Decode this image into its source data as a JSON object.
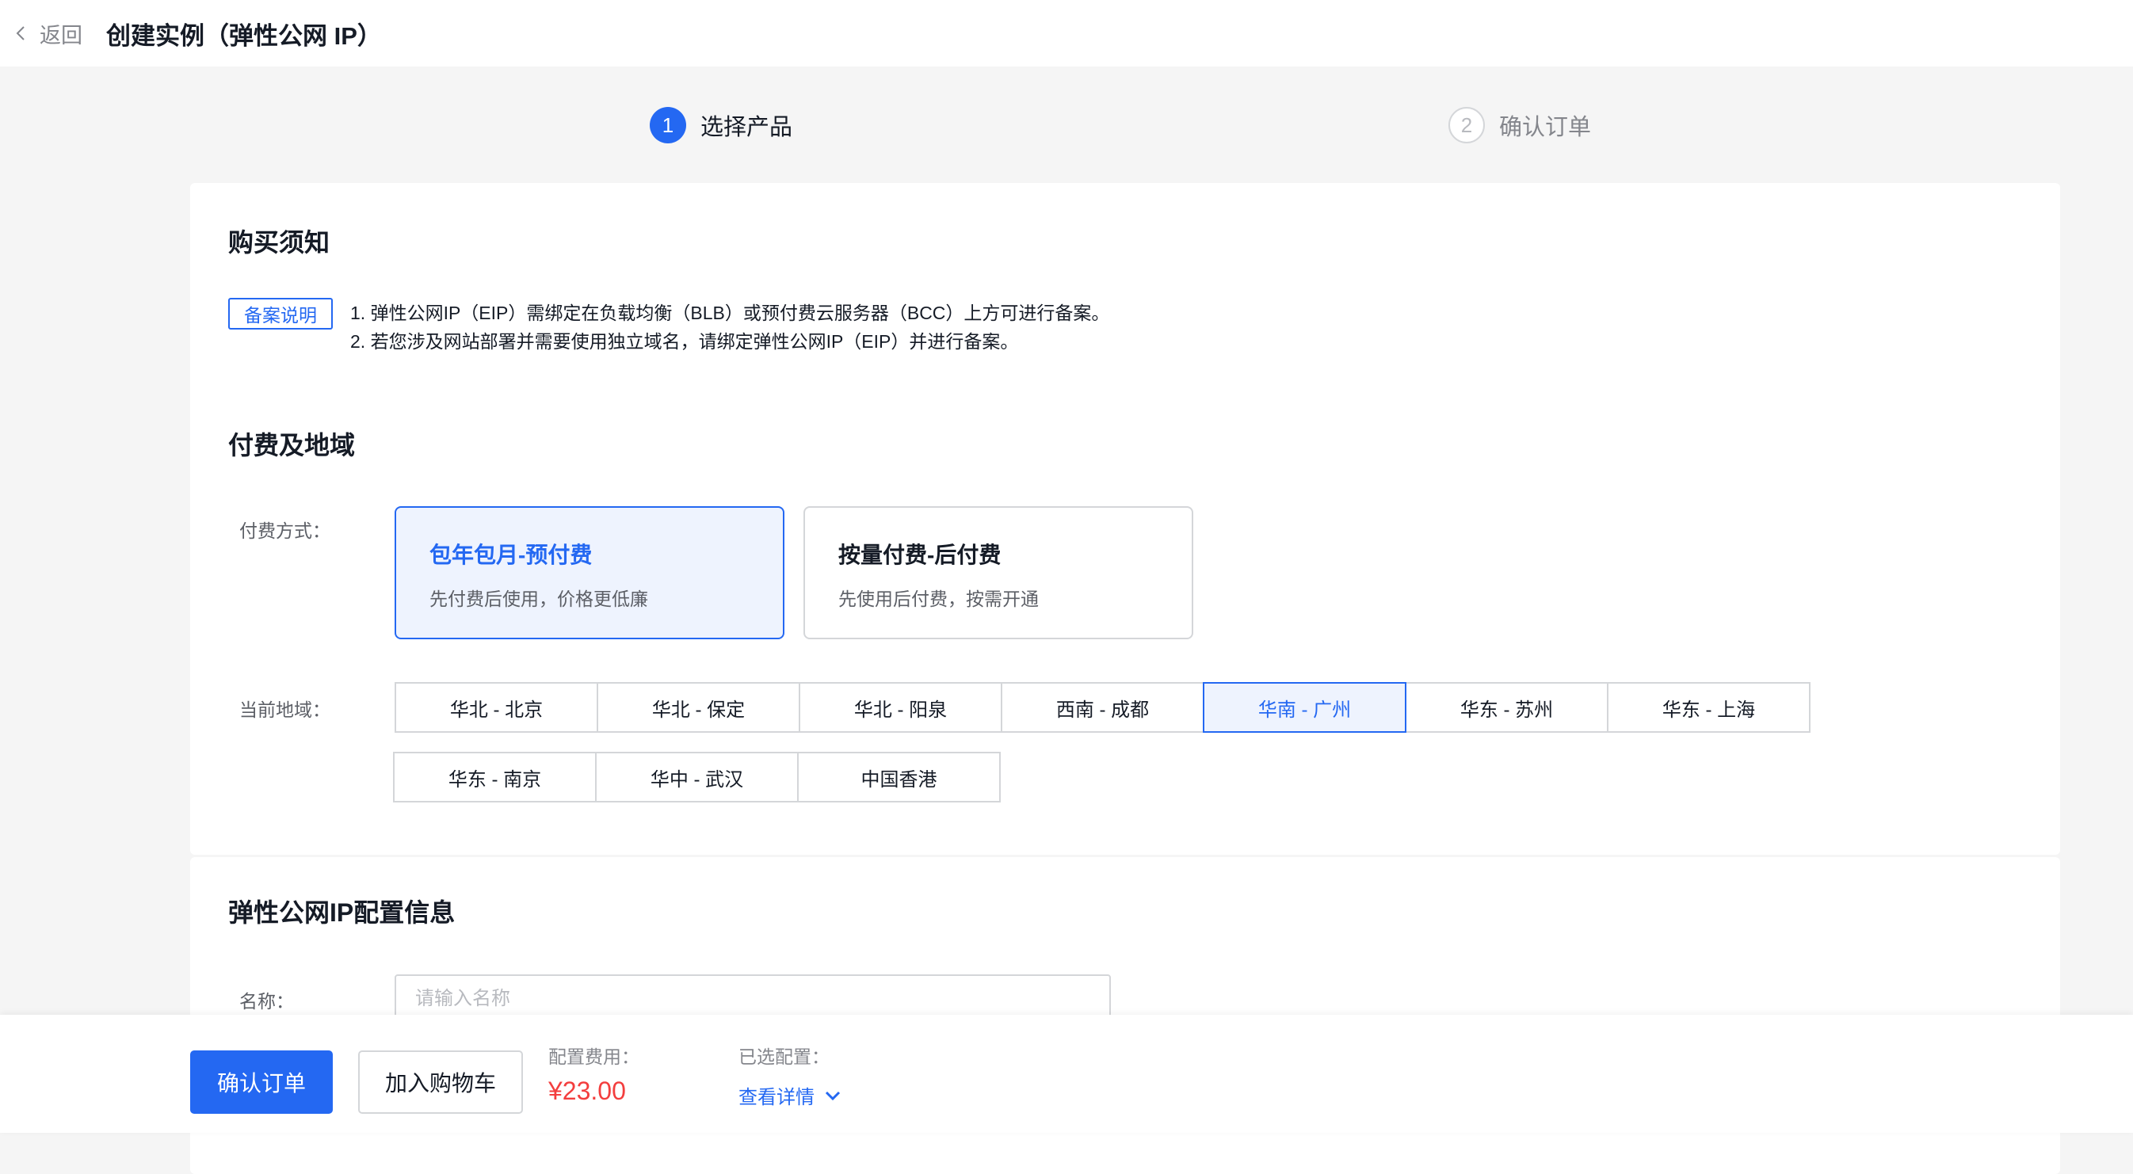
{
  "header": {
    "back_label": "返回",
    "title": "创建实例（弹性公网 IP）"
  },
  "steps": [
    {
      "number": "1",
      "label": "选择产品",
      "state": "active"
    },
    {
      "number": "2",
      "label": "确认订单",
      "state": "inactive"
    }
  ],
  "notice": {
    "section_title": "购买须知",
    "tag": "备案说明",
    "lines": [
      "1. 弹性公网IP（EIP）需绑定在负载均衡（BLB）或预付费云服务器（BCC）上方可进行备案。",
      "2. 若您涉及网站部署并需要使用独立域名，请绑定弹性公网IP（EIP）并进行备案。"
    ]
  },
  "billing": {
    "section_title": "付费及地域",
    "pay_label": "付费方式：",
    "pay_options": [
      {
        "title": "包年包月-预付费",
        "desc": "先付费后使用，价格更低廉",
        "selected": true
      },
      {
        "title": "按量付费-后付费",
        "desc": "先使用后付费，按需开通",
        "selected": false
      }
    ],
    "region_label": "当前地域：",
    "regions_row1": [
      "华北 - 北京",
      "华北 - 保定",
      "华北 - 阳泉",
      "西南 - 成都",
      "华南 - 广州",
      "华东 - 苏州",
      "华东 - 上海"
    ],
    "regions_row2": [
      "华东 - 南京",
      "华中 - 武汉",
      "中国香港"
    ],
    "selected_region": "华南 - 广州"
  },
  "config": {
    "section_title": "弹性公网IP配置信息",
    "name_label": "名称：",
    "name_placeholder": "请输入名称",
    "name_value": ""
  },
  "footer": {
    "confirm_label": "确认订单",
    "cart_label": "加入购物车",
    "fee_label": "配置费用：",
    "fee_value": "¥23.00",
    "selected_label": "已选配置：",
    "detail_link": "查看详情"
  },
  "colors": {
    "accent": "#2468f2",
    "price": "#f33e3e",
    "selected_bg": "#eef3fe",
    "page_bg": "#f5f5f5"
  }
}
